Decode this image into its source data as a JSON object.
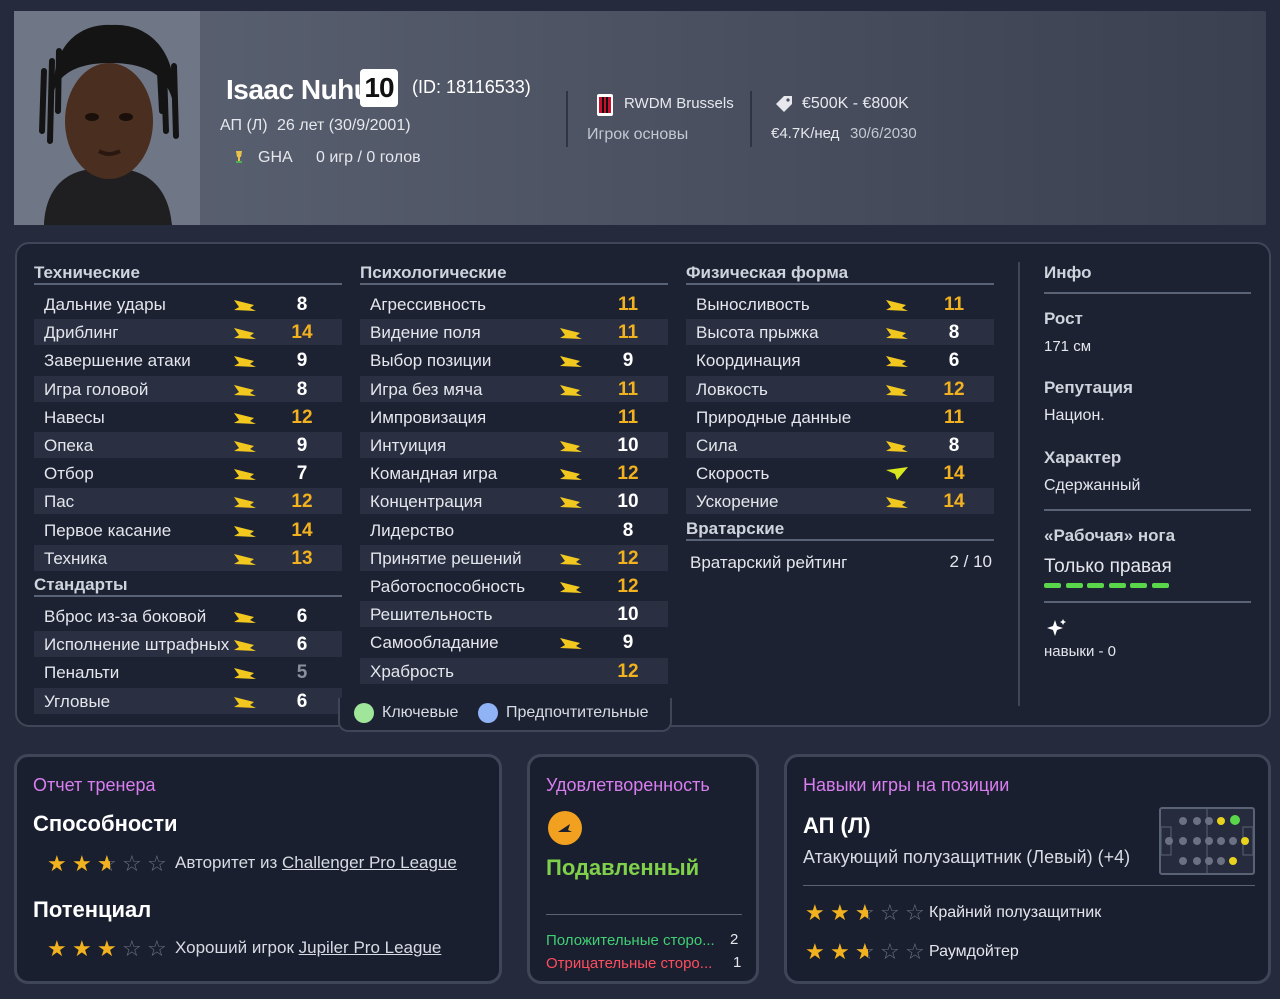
{
  "player": {
    "name": "Isaac Nuhu",
    "number": "10",
    "id_text": "(ID: 18116533)",
    "position": "АП (Л)",
    "age_text": "26 лет (30/9/2001)",
    "nation": "GHA",
    "apps_text": "0 игр / 0 голов",
    "club": "RWDM Brussels",
    "squad_status": "Игрок основы",
    "value_range": "€500K - €800K",
    "wage": "€4.7K/нед",
    "contract_end": "30/6/2030"
  },
  "sections": {
    "technical": {
      "title": "Технические",
      "rows": [
        {
          "label": "Дальние удары",
          "value": "8",
          "color": "w",
          "arrow": "up"
        },
        {
          "label": "Дриблинг",
          "value": "14",
          "color": "y",
          "arrow": "up"
        },
        {
          "label": "Завершение атаки",
          "value": "9",
          "color": "w",
          "arrow": "up"
        },
        {
          "label": "Игра головой",
          "value": "8",
          "color": "w",
          "arrow": "up"
        },
        {
          "label": "Навесы",
          "value": "12",
          "color": "y",
          "arrow": "up"
        },
        {
          "label": "Опека",
          "value": "9",
          "color": "w",
          "arrow": "up"
        },
        {
          "label": "Отбор",
          "value": "7",
          "color": "w",
          "arrow": "up"
        },
        {
          "label": "Пас",
          "value": "12",
          "color": "y",
          "arrow": "up"
        },
        {
          "label": "Первое касание",
          "value": "14",
          "color": "y",
          "arrow": "up"
        },
        {
          "label": "Техника",
          "value": "13",
          "color": "y",
          "arrow": "up"
        }
      ]
    },
    "setpieces": {
      "title": "Стандарты",
      "rows": [
        {
          "label": "Вброс из-за боковой",
          "value": "6",
          "color": "w",
          "arrow": "up"
        },
        {
          "label": "Исполнение штрафных",
          "value": "6",
          "color": "w",
          "arrow": "up"
        },
        {
          "label": "Пенальти",
          "value": "5",
          "color": "g",
          "arrow": "up"
        },
        {
          "label": "Угловые",
          "value": "6",
          "color": "w",
          "arrow": "up"
        }
      ]
    },
    "mental": {
      "title": "Психологические",
      "rows": [
        {
          "label": "Агрессивность",
          "value": "11",
          "color": "y",
          "arrow": ""
        },
        {
          "label": "Видение поля",
          "value": "11",
          "color": "y",
          "arrow": "up"
        },
        {
          "label": "Выбор позиции",
          "value": "9",
          "color": "w",
          "arrow": "up"
        },
        {
          "label": "Игра без мяча",
          "value": "11",
          "color": "y",
          "arrow": "up"
        },
        {
          "label": "Импровизация",
          "value": "11",
          "color": "y",
          "arrow": ""
        },
        {
          "label": "Интуиция",
          "value": "10",
          "color": "w",
          "arrow": "up"
        },
        {
          "label": "Командная игра",
          "value": "12",
          "color": "y",
          "arrow": "up"
        },
        {
          "label": "Концентрация",
          "value": "10",
          "color": "w",
          "arrow": "up"
        },
        {
          "label": "Лидерство",
          "value": "8",
          "color": "w",
          "arrow": ""
        },
        {
          "label": "Принятие решений",
          "value": "12",
          "color": "y",
          "arrow": "up"
        },
        {
          "label": "Работоспособность",
          "value": "12",
          "color": "y",
          "arrow": "up"
        },
        {
          "label": "Решительность",
          "value": "10",
          "color": "w",
          "arrow": ""
        },
        {
          "label": "Самообладание",
          "value": "9",
          "color": "w",
          "arrow": "up"
        },
        {
          "label": "Храбрость",
          "value": "12",
          "color": "y",
          "arrow": ""
        }
      ]
    },
    "physical": {
      "title": "Физическая форма",
      "rows": [
        {
          "label": "Выносливость",
          "value": "11",
          "color": "y",
          "arrow": "up"
        },
        {
          "label": "Высота прыжка",
          "value": "8",
          "color": "w",
          "arrow": "up"
        },
        {
          "label": "Координация",
          "value": "6",
          "color": "w",
          "arrow": "up"
        },
        {
          "label": "Ловкость",
          "value": "12",
          "color": "y",
          "arrow": "up"
        },
        {
          "label": "Природные данные",
          "value": "11",
          "color": "y",
          "arrow": ""
        },
        {
          "label": "Сила",
          "value": "8",
          "color": "w",
          "arrow": "up"
        },
        {
          "label": "Скорость",
          "value": "14",
          "color": "y",
          "arrow": "strong"
        },
        {
          "label": "Ускорение",
          "value": "14",
          "color": "y",
          "arrow": "up"
        }
      ]
    },
    "goalkeeping": {
      "title": "Вратарские",
      "rating_label": "Вратарский рейтинг",
      "rating_value": "2 / 10"
    }
  },
  "info": {
    "title": "Инфо",
    "height_label": "Рост",
    "height_value": "171 см",
    "reputation_label": "Репутация",
    "reputation_value": "Национ.",
    "personality_label": "Характер",
    "personality_value": "Сдержанный",
    "foot_label": "«Рабочая» нога",
    "foot_value": "Только правая",
    "traits_text": "навыки - 0"
  },
  "legend": {
    "key": "Ключевые",
    "preferred": "Предпочтительные",
    "key_color": "#9fe59a",
    "preferred_color": "#8fb3f5"
  },
  "coach_report": {
    "title": "Отчет тренера",
    "ability_heading": "Способности",
    "ability_stars": 2.5,
    "ability_prefix": "Авторитет из ",
    "ability_league": "Challenger Pro League",
    "potential_heading": "Потенциал",
    "potential_stars": 3,
    "potential_prefix": "Хороший игрок ",
    "potential_league": "Jupiler Pro League"
  },
  "happiness": {
    "title": "Удовлетворенность",
    "status": "Подавленный",
    "positives_label": "Положительные сторо...",
    "positives_count": "2",
    "negatives_label": "Отрицательные сторо...",
    "negatives_count": "1"
  },
  "position_skills": {
    "title": "Навыки игры на позиции",
    "position": "АП (Л)",
    "role_text": "Атакующий полузащитник (Левый) (+4)",
    "roles": [
      {
        "name": "Крайний полузащитник",
        "stars": 2.5
      },
      {
        "name": "Раумдойтер",
        "stars": 2.5
      }
    ]
  },
  "colors": {
    "accent_yellow": "#f2b11e",
    "accent_pink": "#d97ef0",
    "happiness_green": "#7fd04a",
    "positive_green": "#3fcf74",
    "negative_red": "#ff4d5e",
    "foot_bar_green": "#5ad64a"
  }
}
